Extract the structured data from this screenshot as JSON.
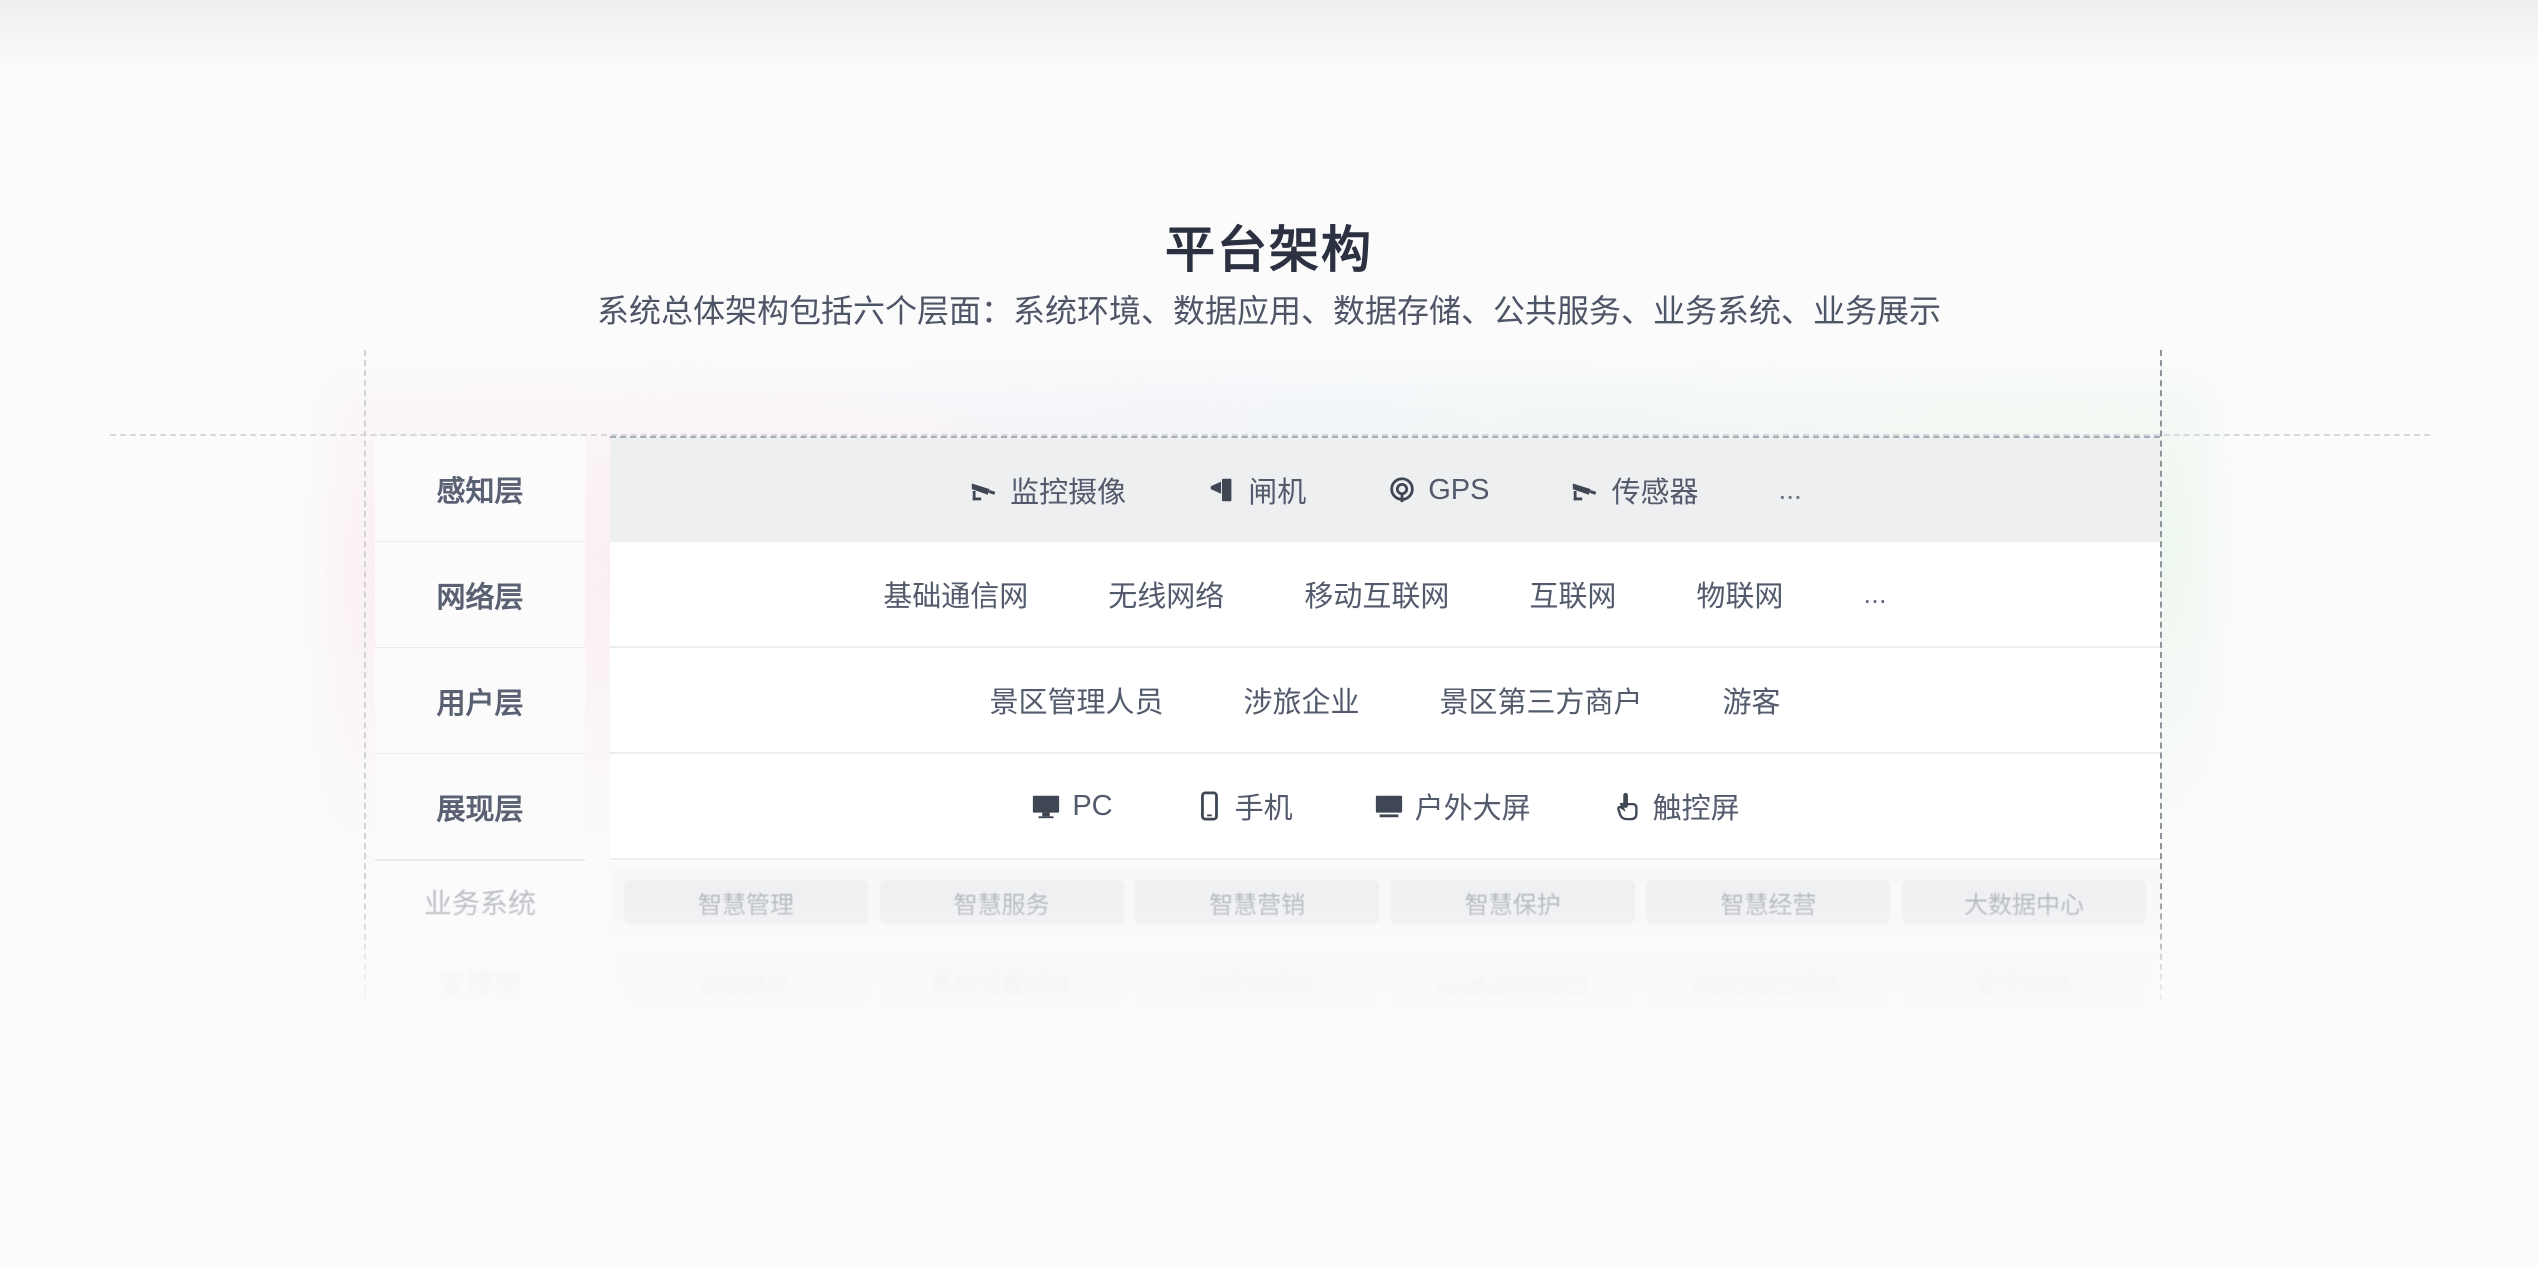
{
  "header": {
    "title": "平台架构",
    "subtitle": "系统总体架构包括六个层面：系统环境、数据应用、数据存储、公共服务、业务系统、业务展示"
  },
  "layers": [
    {
      "label": "感知层",
      "items": [
        {
          "text": "监控摄像",
          "icon": "camera-icon"
        },
        {
          "text": "闸机",
          "icon": "gate-icon"
        },
        {
          "text": "GPS",
          "icon": "gps-icon"
        },
        {
          "text": "传感器",
          "icon": "sensor-icon"
        }
      ],
      "more": "..."
    },
    {
      "label": "网络层",
      "items": [
        {
          "text": "基础通信网"
        },
        {
          "text": "无线网络"
        },
        {
          "text": "移动互联网"
        },
        {
          "text": "互联网"
        },
        {
          "text": "物联网"
        }
      ],
      "more": "..."
    },
    {
      "label": "用户层",
      "items": [
        {
          "text": "景区管理人员"
        },
        {
          "text": "涉旅企业"
        },
        {
          "text": "景区第三方商户"
        },
        {
          "text": "游客"
        }
      ]
    },
    {
      "label": "展现层",
      "items": [
        {
          "text": "PC",
          "icon": "desktop-icon"
        },
        {
          "text": "手机",
          "icon": "mobile-icon"
        },
        {
          "text": "户外大屏",
          "icon": "screen-icon"
        },
        {
          "text": "触控屏",
          "icon": "touch-icon"
        }
      ]
    }
  ],
  "faded_layers": [
    {
      "label": "业务系统",
      "items": [
        "智慧管理",
        "智慧服务",
        "智慧营销",
        "智慧保护",
        "智慧经营",
        "大数据中心"
      ]
    },
    {
      "label": "支撑层",
      "items": [
        "GIS组件",
        "系统设置组件",
        "消息中间件",
        "restfulAPI接口",
        "PDO接口组件",
        "安全组件"
      ]
    }
  ],
  "colors": {
    "title": "#2b3140",
    "text": "#525a6b",
    "panel_grey": "#eeeff1",
    "icon": "#3f4654"
  }
}
